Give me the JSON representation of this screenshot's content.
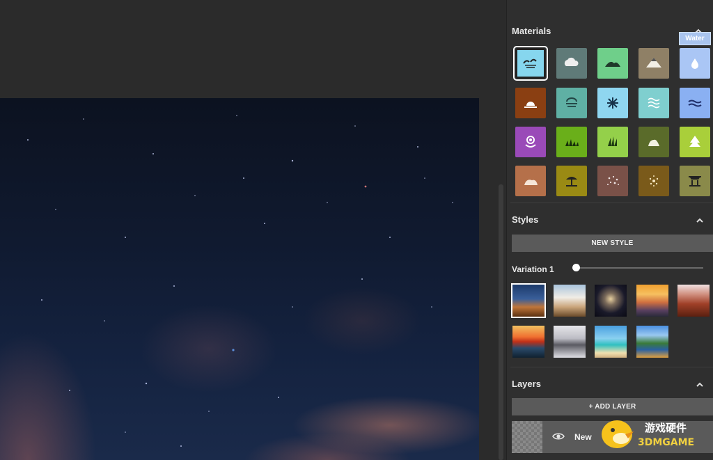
{
  "materials": {
    "title": "Materials",
    "tooltip": "Water",
    "tiles": [
      {
        "name": "sea",
        "color": "#86d6ee",
        "icon": "sea-icon"
      },
      {
        "name": "cloud",
        "color": "#5f7a78",
        "icon": "cloud-icon"
      },
      {
        "name": "hill",
        "color": "#6fcf8a",
        "icon": "hill-icon"
      },
      {
        "name": "mountain",
        "color": "#8f8066",
        "icon": "mountain-icon"
      },
      {
        "name": "water",
        "color": "#aac6f5",
        "icon": "drop-icon"
      },
      {
        "name": "sunset",
        "color": "#8a3f12",
        "icon": "sunset-icon"
      },
      {
        "name": "fog",
        "color": "#5fb0a4",
        "icon": "fog-icon"
      },
      {
        "name": "snow",
        "color": "#8fd6f0",
        "icon": "snowflake-icon"
      },
      {
        "name": "river",
        "color": "#7fcfcf",
        "icon": "wave-lines-icon"
      },
      {
        "name": "lake",
        "color": "#8ab0f2",
        "icon": "wave-icon"
      },
      {
        "name": "flower",
        "color": "#9a4ab8",
        "icon": "flower-icon"
      },
      {
        "name": "grass",
        "color": "#6aaf1a",
        "icon": "grass-icon"
      },
      {
        "name": "plant",
        "color": "#94d04a",
        "icon": "plant-icon"
      },
      {
        "name": "rock",
        "color": "#5a6b2a",
        "icon": "rock-icon"
      },
      {
        "name": "tree",
        "color": "#a9cf3a",
        "icon": "tree-icon"
      },
      {
        "name": "dirt",
        "color": "#b5704a",
        "icon": "dirt-icon"
      },
      {
        "name": "sand",
        "color": "#9a8a14",
        "icon": "beach-icon"
      },
      {
        "name": "gravel",
        "color": "#7a5148",
        "icon": "gravel-icon"
      },
      {
        "name": "stone",
        "color": "#7a5a1a",
        "icon": "stone-icon"
      },
      {
        "name": "building",
        "color": "#8a8a4a",
        "icon": "building-icon"
      }
    ]
  },
  "styles": {
    "title": "Styles",
    "new_style_label": "NEW STYLE",
    "variation_label": "Variation 1",
    "variation_value": 0.0,
    "thumbnails": [
      {
        "name": "night-desert"
      },
      {
        "name": "cloudy-cliffs"
      },
      {
        "name": "starry-arch"
      },
      {
        "name": "sunset-valley"
      },
      {
        "name": "red-rocks"
      },
      {
        "name": "sunset-sea"
      },
      {
        "name": "snowy-peaks"
      },
      {
        "name": "tropical-beach"
      },
      {
        "name": "mountain-lake"
      }
    ]
  },
  "layers": {
    "title": "Layers",
    "add_label": "+ ADD LAYER",
    "items": [
      {
        "name": "New"
      }
    ]
  },
  "watermark": {
    "text_cn": "游戏硬件",
    "text_en": "3DMGAME"
  }
}
